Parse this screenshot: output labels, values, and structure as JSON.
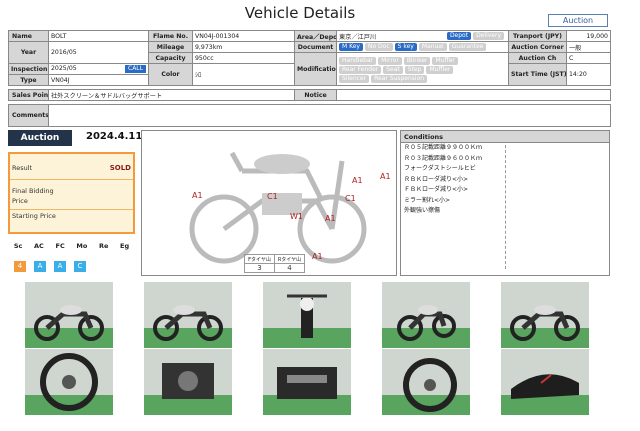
{
  "page": {
    "title": "Vehicle Details",
    "auction_tag": "Auction"
  },
  "spec": {
    "name_label": "Name",
    "name": "BOLT",
    "frame_label": "Flame No.",
    "frame": "VN04J-001304",
    "area_label": "Area／Depot",
    "area": "東京／江戸川",
    "area_tags": [
      "Depot",
      "Delivery"
    ],
    "transport_label": "Tranport (JPY)",
    "transport": "19,000",
    "year_label": "Year",
    "year": "2016/05",
    "mileage_label": "Mileage",
    "mileage": "9,973km",
    "document_label": "Document",
    "document_tags": [
      "M Key",
      "No Doc",
      "S key",
      "Manual",
      "Guarantee"
    ],
    "corner_label": "Auction Corner",
    "corner": "一般",
    "capacity_label": "Capacity",
    "capacity": "950cc",
    "modification_label": "Modification",
    "mod_tags_1": [
      "Handlebar",
      "Mirror",
      "Blinker",
      "Muffer"
    ],
    "mod_tags_2": [
      "Rear Fender",
      "Seat",
      "Step",
      "Muffler"
    ],
    "mod_tags_3": [
      "Silencer",
      "Rear Suspension"
    ],
    "auction_ch_label": "Auction Ch",
    "auction_ch": "C",
    "inspection_label": "Inspection",
    "inspection": "2025/05",
    "inspection_badge": "CALL",
    "color_label": "Color",
    "color": "ｼﾛ",
    "start_label": "Start Time (JST)",
    "start": "14:20",
    "type_label": "Type",
    "type": "VN04J",
    "sales_label": "Sales Point",
    "sales": "社外スクリーン＆サドルバッグサポート",
    "notice_label": "Notice",
    "notice": "",
    "comments_label": "Comments",
    "comments": ""
  },
  "auction": {
    "date_label": "Auction date",
    "date": "2024.4.11"
  },
  "result": {
    "result_label": "Result",
    "result": "SOLD",
    "final_label_1": "Final Bidding",
    "final_label_2": "Price",
    "starting_label": "Starting Price"
  },
  "grades": {
    "headers": [
      "Sc",
      "AC",
      "FC",
      "Mo",
      "Re",
      "Eg"
    ],
    "values": [
      "4",
      "A",
      "A",
      "C"
    ],
    "colors": [
      "#f29a3c",
      "#3aaee8",
      "#3aaee8",
      "#3aaee8"
    ]
  },
  "diagram": {
    "marks": [
      "A1",
      "C1",
      "A1",
      "A1",
      "C1",
      "W1",
      "A1",
      "A1"
    ],
    "front_tire_label": "Fタイヤ山",
    "rear_tire_label": "Rタイヤ山",
    "front_tire": "3",
    "rear_tire": "4"
  },
  "conditions": {
    "label": "Conditions",
    "lines": [
      "Ｒ０５記載距離９９００Ｋｍ",
      "Ｒ０３記載距離９６００Ｋｍ",
      "フォークダストシールヒビ",
      "ＲＢＫローダ減り<小>",
      "ＦＢＫローダ減り<小>",
      "ミラー割れ<小>",
      "外観強い擦傷"
    ]
  },
  "photos": [
    "left side",
    "right side",
    "front",
    "rear quarter",
    "right side 2",
    "front wheel",
    "engine left",
    "engine",
    "rear wheel",
    "seat"
  ]
}
